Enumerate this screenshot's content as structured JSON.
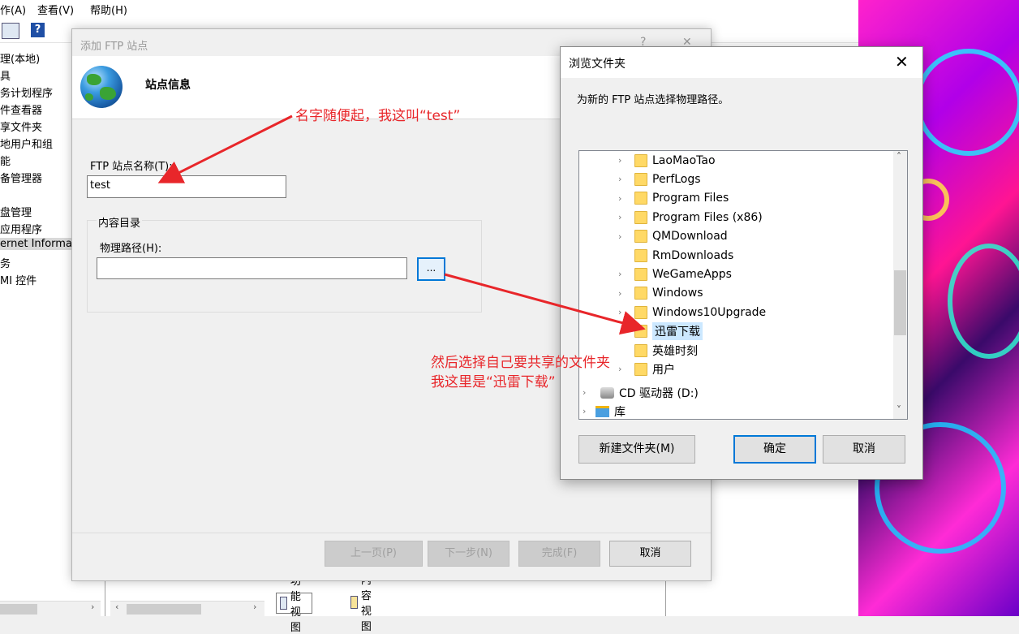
{
  "menubar": {
    "items": [
      "作(A)",
      "查看(V)",
      "帮助(H)"
    ]
  },
  "tree": {
    "items": [
      "理(本地)",
      "具",
      "务计划程序",
      "件查看器",
      "享文件夹",
      "地用户和组",
      "能",
      "备管理器",
      "",
      "盘管理",
      "应用程序",
      "ernet Informat",
      "务",
      "MI 控件"
    ]
  },
  "bottom_tabs": {
    "feature_view": "功能视图",
    "content_view": "内容视图"
  },
  "scroll_arrows": {
    "right": "›",
    "left": "‹"
  },
  "wizard": {
    "title": "添加 FTP 站点",
    "help": "?",
    "close": "✕",
    "heading": "站点信息",
    "site_name_label": "FTP 站点名称(T):",
    "site_name_value": "test",
    "content_group": "内容目录",
    "physical_path_label": "物理路径(H):",
    "physical_path_value": "",
    "browse_button": "...",
    "buttons": {
      "prev": "上一页(P)",
      "next": "下一步(N)",
      "finish": "完成(F)",
      "cancel": "取消"
    }
  },
  "browse_dialog": {
    "title": "浏览文件夹",
    "close": "✕",
    "description": "为新的 FTP 站点选择物理路径。",
    "folders": [
      {
        "name": "LaoMaoTao",
        "chev": "›"
      },
      {
        "name": "PerfLogs",
        "chev": "›"
      },
      {
        "name": "Program Files",
        "chev": "›"
      },
      {
        "name": "Program Files (x86)",
        "chev": "›"
      },
      {
        "name": "QMDownload",
        "chev": "›"
      },
      {
        "name": "RmDownloads",
        "chev": ""
      },
      {
        "name": "WeGameApps",
        "chev": "›"
      },
      {
        "name": "Windows",
        "chev": "›"
      },
      {
        "name": "Windows10Upgrade",
        "chev": "›"
      },
      {
        "name": "迅雷下载",
        "chev": "",
        "selected": true
      },
      {
        "name": "英雄时刻",
        "chev": ""
      },
      {
        "name": "用户",
        "chev": "›"
      }
    ],
    "drive": {
      "name": "CD 驱动器 (D:)",
      "chev": "›"
    },
    "library": {
      "name": "库",
      "chev": "›"
    },
    "scroll_up": "˄",
    "scroll_down": "˅",
    "buttons": {
      "new_folder": "新建文件夹(M)",
      "ok": "确定",
      "cancel": "取消"
    }
  },
  "annotations": {
    "name_hint": "名字随便起，我这叫“test”",
    "folder_hint_line1": "然后选择自己要共享的文件夹",
    "folder_hint_line2": "我这里是“迅雷下载”"
  },
  "colors": {
    "annotation": "#e8262a",
    "selection": "#cce8ff",
    "accent": "#0078d7"
  }
}
